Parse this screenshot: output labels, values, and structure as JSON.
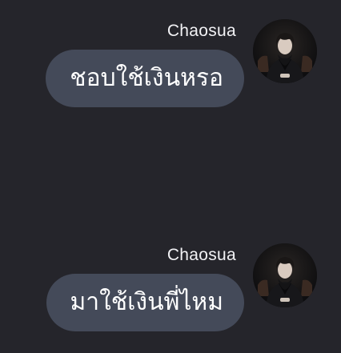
{
  "messages": [
    {
      "sender": "Chaosua",
      "text": "ชอบใช้เงินหรอ",
      "avatar_icon": "user-avatar-photo"
    },
    {
      "sender": "Chaosua",
      "text": "มาใช้เงินพี่ไหม",
      "avatar_icon": "user-avatar-photo"
    }
  ],
  "colors": {
    "background": "#25252b",
    "bubble": "#444a59",
    "text": "#ffffff",
    "sender_name": "#f2f2f5"
  }
}
